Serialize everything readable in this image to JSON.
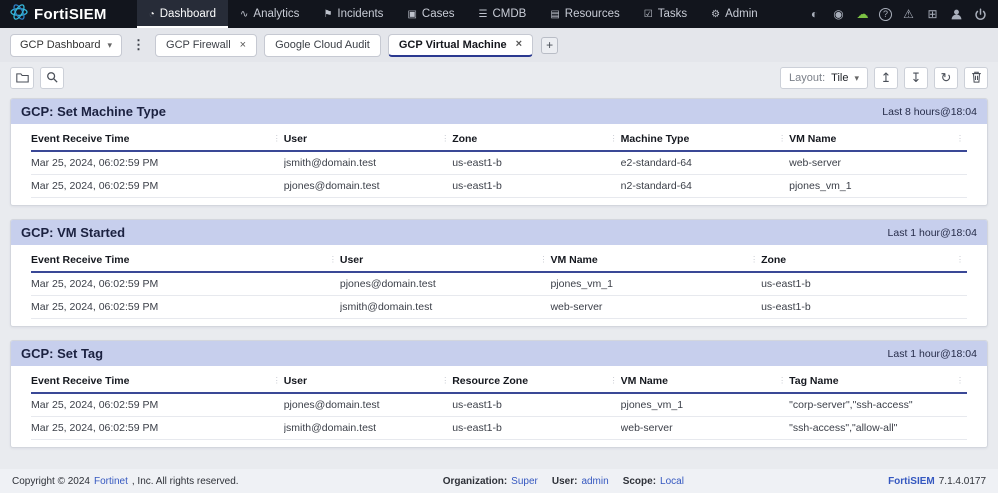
{
  "colors": {
    "navbar_bg": "#12151d",
    "accent_blue": "#2b3990",
    "panel_header_bg": "#c7cfed",
    "table_header_rule": "#3a4896",
    "link_blue": "#3558c0",
    "cloud_green": "#7bc143"
  },
  "icons": {
    "caret": "▾",
    "kebab": "⋮",
    "close": "×",
    "add_tab": "+",
    "upload": "↥",
    "download": "↧",
    "refresh": "↻"
  },
  "navbar": {
    "brand": "FortiSIEM",
    "items": [
      {
        "label": "Dashboard",
        "icon": "◔"
      },
      {
        "label": "Analytics",
        "icon": "∿"
      },
      {
        "label": "Incidents",
        "icon": "⚑"
      },
      {
        "label": "Cases",
        "icon": "▣"
      },
      {
        "label": "CMDB",
        "icon": "☰"
      },
      {
        "label": "Resources",
        "icon": "▤"
      },
      {
        "label": "Tasks",
        "icon": "☑"
      },
      {
        "label": "Admin",
        "icon": "⚙"
      }
    ],
    "right_icons": [
      {
        "name": "globe-icon",
        "glyph": "◐"
      },
      {
        "name": "eye-icon",
        "glyph": "◉"
      },
      {
        "name": "cloud-icon",
        "glyph": "☁"
      },
      {
        "name": "help-icon",
        "glyph": "?"
      },
      {
        "name": "warning-icon",
        "glyph": "⚠"
      },
      {
        "name": "apps-icon",
        "glyph": "⊞"
      }
    ]
  },
  "tabbar": {
    "selector_label": "GCP Dashboard",
    "tabs": [
      {
        "label": "GCP Firewall",
        "closable": true,
        "active": false
      },
      {
        "label": "Google Cloud Audit",
        "closable": false,
        "active": false
      },
      {
        "label": "GCP Virtual Machine",
        "closable": true,
        "active": true
      }
    ]
  },
  "toolbar": {
    "layout_label": "Layout:",
    "layout_value": "Tile"
  },
  "panels": [
    {
      "title": "GCP: Set Machine Type",
      "time_range": "Last 8 hours@18:04",
      "table": {
        "columns": [
          "Event Receive Time",
          "User",
          "Zone",
          "Machine Type",
          "VM Name"
        ],
        "rows": [
          [
            "Mar 25, 2024, 06:02:59 PM",
            "jsmith@domain.test",
            "us-east1-b",
            "e2-standard-64",
            "web-server"
          ],
          [
            "Mar 25, 2024, 06:02:59 PM",
            "pjones@domain.test",
            "us-east1-b",
            "n2-standard-64",
            "pjones_vm_1"
          ]
        ]
      }
    },
    {
      "title": "GCP: VM Started",
      "time_range": "Last 1 hour@18:04",
      "table": {
        "columns": [
          "Event Receive Time",
          "User",
          "VM Name",
          "Zone"
        ],
        "rows": [
          [
            "Mar 25, 2024, 06:02:59 PM",
            "pjones@domain.test",
            "pjones_vm_1",
            "us-east1-b"
          ],
          [
            "Mar 25, 2024, 06:02:59 PM",
            "jsmith@domain.test",
            "web-server",
            "us-east1-b"
          ]
        ]
      }
    },
    {
      "title": "GCP: Set Tag",
      "time_range": "Last 1 hour@18:04",
      "table": {
        "columns": [
          "Event Receive Time",
          "User",
          "Resource Zone",
          "VM Name",
          "Tag Name"
        ],
        "rows": [
          [
            "Mar 25, 2024, 06:02:59 PM",
            "pjones@domain.test",
            "us-east1-b",
            "pjones_vm_1",
            "\"corp-server\",\"ssh-access\""
          ],
          [
            "Mar 25, 2024, 06:02:59 PM",
            "jsmith@domain.test",
            "us-east1-b",
            "web-server",
            "\"ssh-access\",\"allow-all\""
          ]
        ]
      }
    }
  ],
  "footer": {
    "copyright_prefix": "Copyright © 2024 ",
    "copyright_link": "Fortinet",
    "copyright_suffix": ", Inc. All rights reserved.",
    "org_label": "Organization:",
    "org_value": "Super",
    "user_label": "User:",
    "user_value": "admin",
    "scope_label": "Scope:",
    "scope_value": "Local",
    "product": "FortiSIEM",
    "version": "7.1.4.0177"
  }
}
